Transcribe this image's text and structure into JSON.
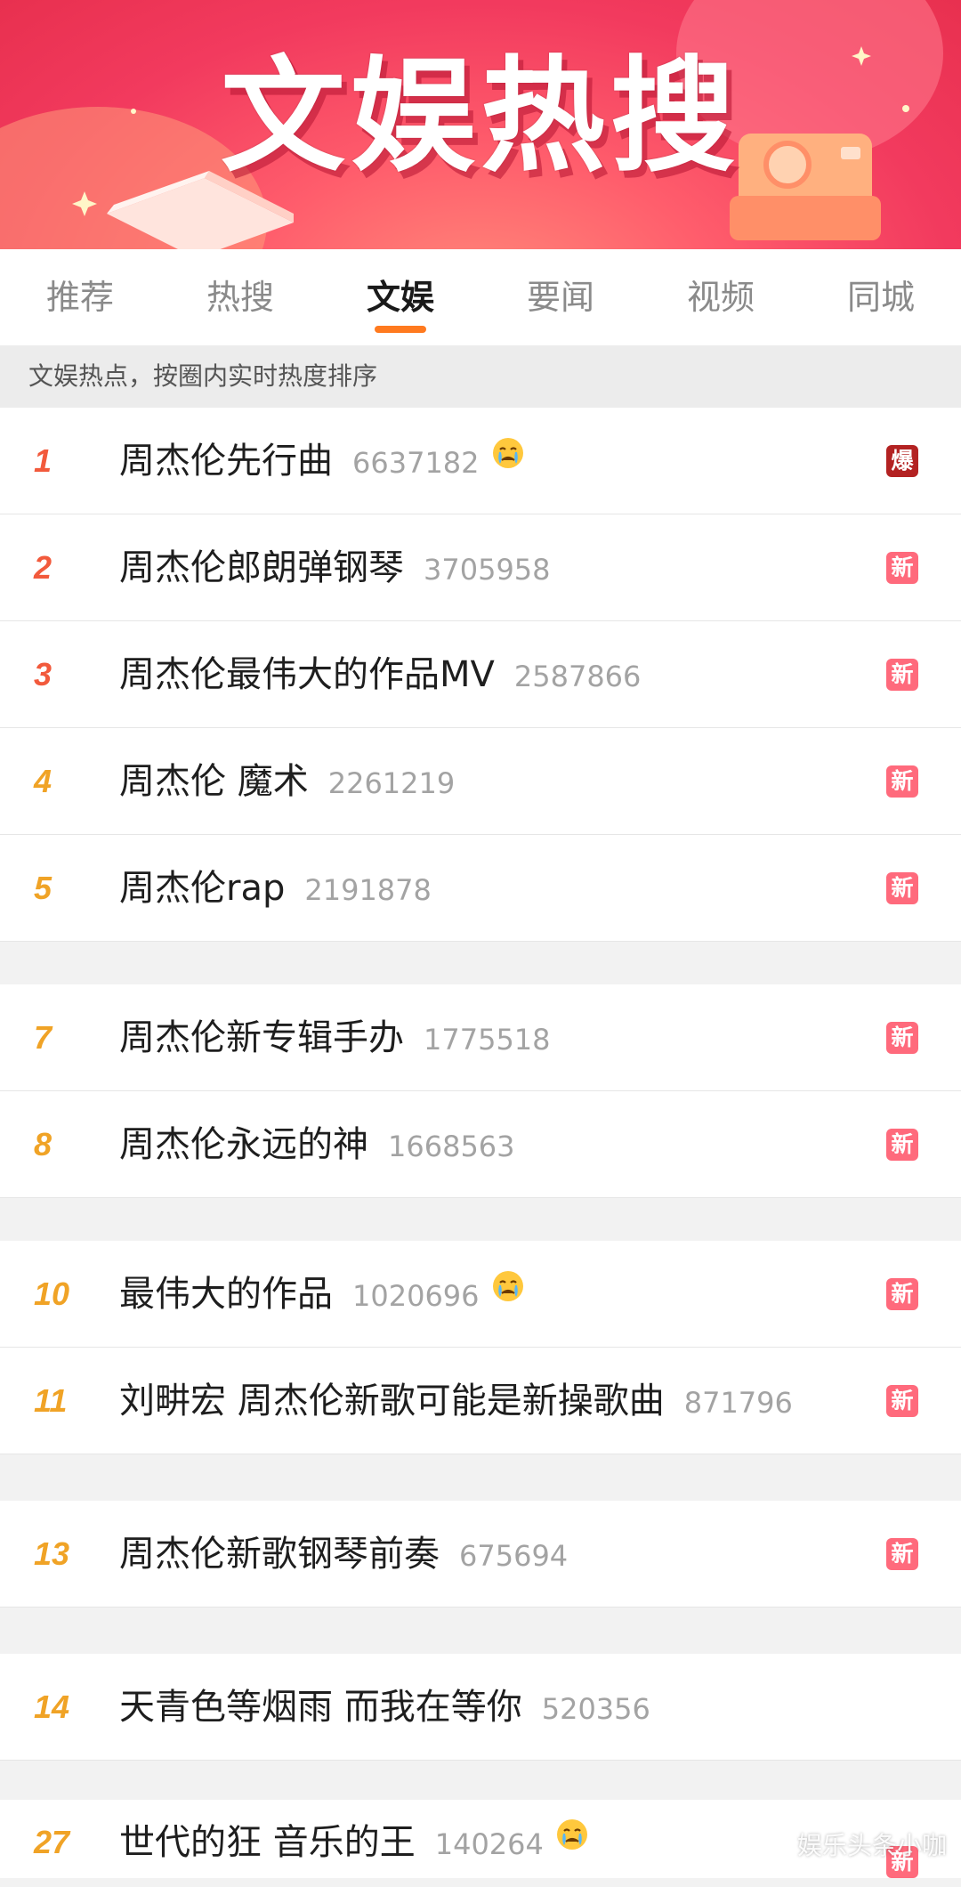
{
  "banner": {
    "title": "文娱热搜"
  },
  "tabs": [
    {
      "label": "推荐",
      "active": false
    },
    {
      "label": "热搜",
      "active": false
    },
    {
      "label": "文娱",
      "active": true
    },
    {
      "label": "要闻",
      "active": false
    },
    {
      "label": "视频",
      "active": false
    },
    {
      "label": "同城",
      "active": false
    }
  ],
  "subheader": "文娱热点，按圈内实时热度排序",
  "list": [
    {
      "rank": "1",
      "title": "周杰伦先行曲",
      "heat": "6637182",
      "emoji": "crying-face-icon",
      "badge": "爆"
    },
    {
      "rank": "2",
      "title": "周杰伦郎朗弹钢琴",
      "heat": "3705958",
      "badge": "新"
    },
    {
      "rank": "3",
      "title": "周杰伦最伟大的作品MV",
      "heat": "2587866",
      "badge": "新"
    },
    {
      "rank": "4",
      "title": "周杰伦 魔术",
      "heat": "2261219",
      "badge": "新"
    },
    {
      "rank": "5",
      "title": "周杰伦rap",
      "heat": "2191878",
      "badge": "新"
    },
    {
      "rank": "7",
      "title": "周杰伦新专辑手办",
      "heat": "1775518",
      "badge": "新"
    },
    {
      "rank": "8",
      "title": "周杰伦永远的神",
      "heat": "1668563",
      "badge": "新"
    },
    {
      "rank": "10",
      "title": "最伟大的作品",
      "heat": "1020696",
      "emoji": "crying-face-icon",
      "badge": "新"
    },
    {
      "rank": "11",
      "title": "刘畊宏 周杰伦新歌可能是新操歌曲",
      "heat": "871796",
      "badge": "新"
    },
    {
      "rank": "13",
      "title": "周杰伦新歌钢琴前奏",
      "heat": "675694",
      "badge": "新"
    },
    {
      "rank": "14",
      "title": "天青色等烟雨 而我在等你",
      "heat": "520356"
    },
    {
      "rank": "27",
      "title": "世代的狂 音乐的王",
      "heat": "140264",
      "emoji": "crying-face-icon",
      "badge": "新"
    }
  ],
  "watermark": "娱乐头条小咖",
  "colors": {
    "banner_red": "#f23a5e",
    "tab_indicator": "#ff7a1f",
    "rank_top": "#f25a3c",
    "rank_mid": "#f0a326",
    "badge_new": "#ff6a7c",
    "badge_hot": "#b32222"
  }
}
